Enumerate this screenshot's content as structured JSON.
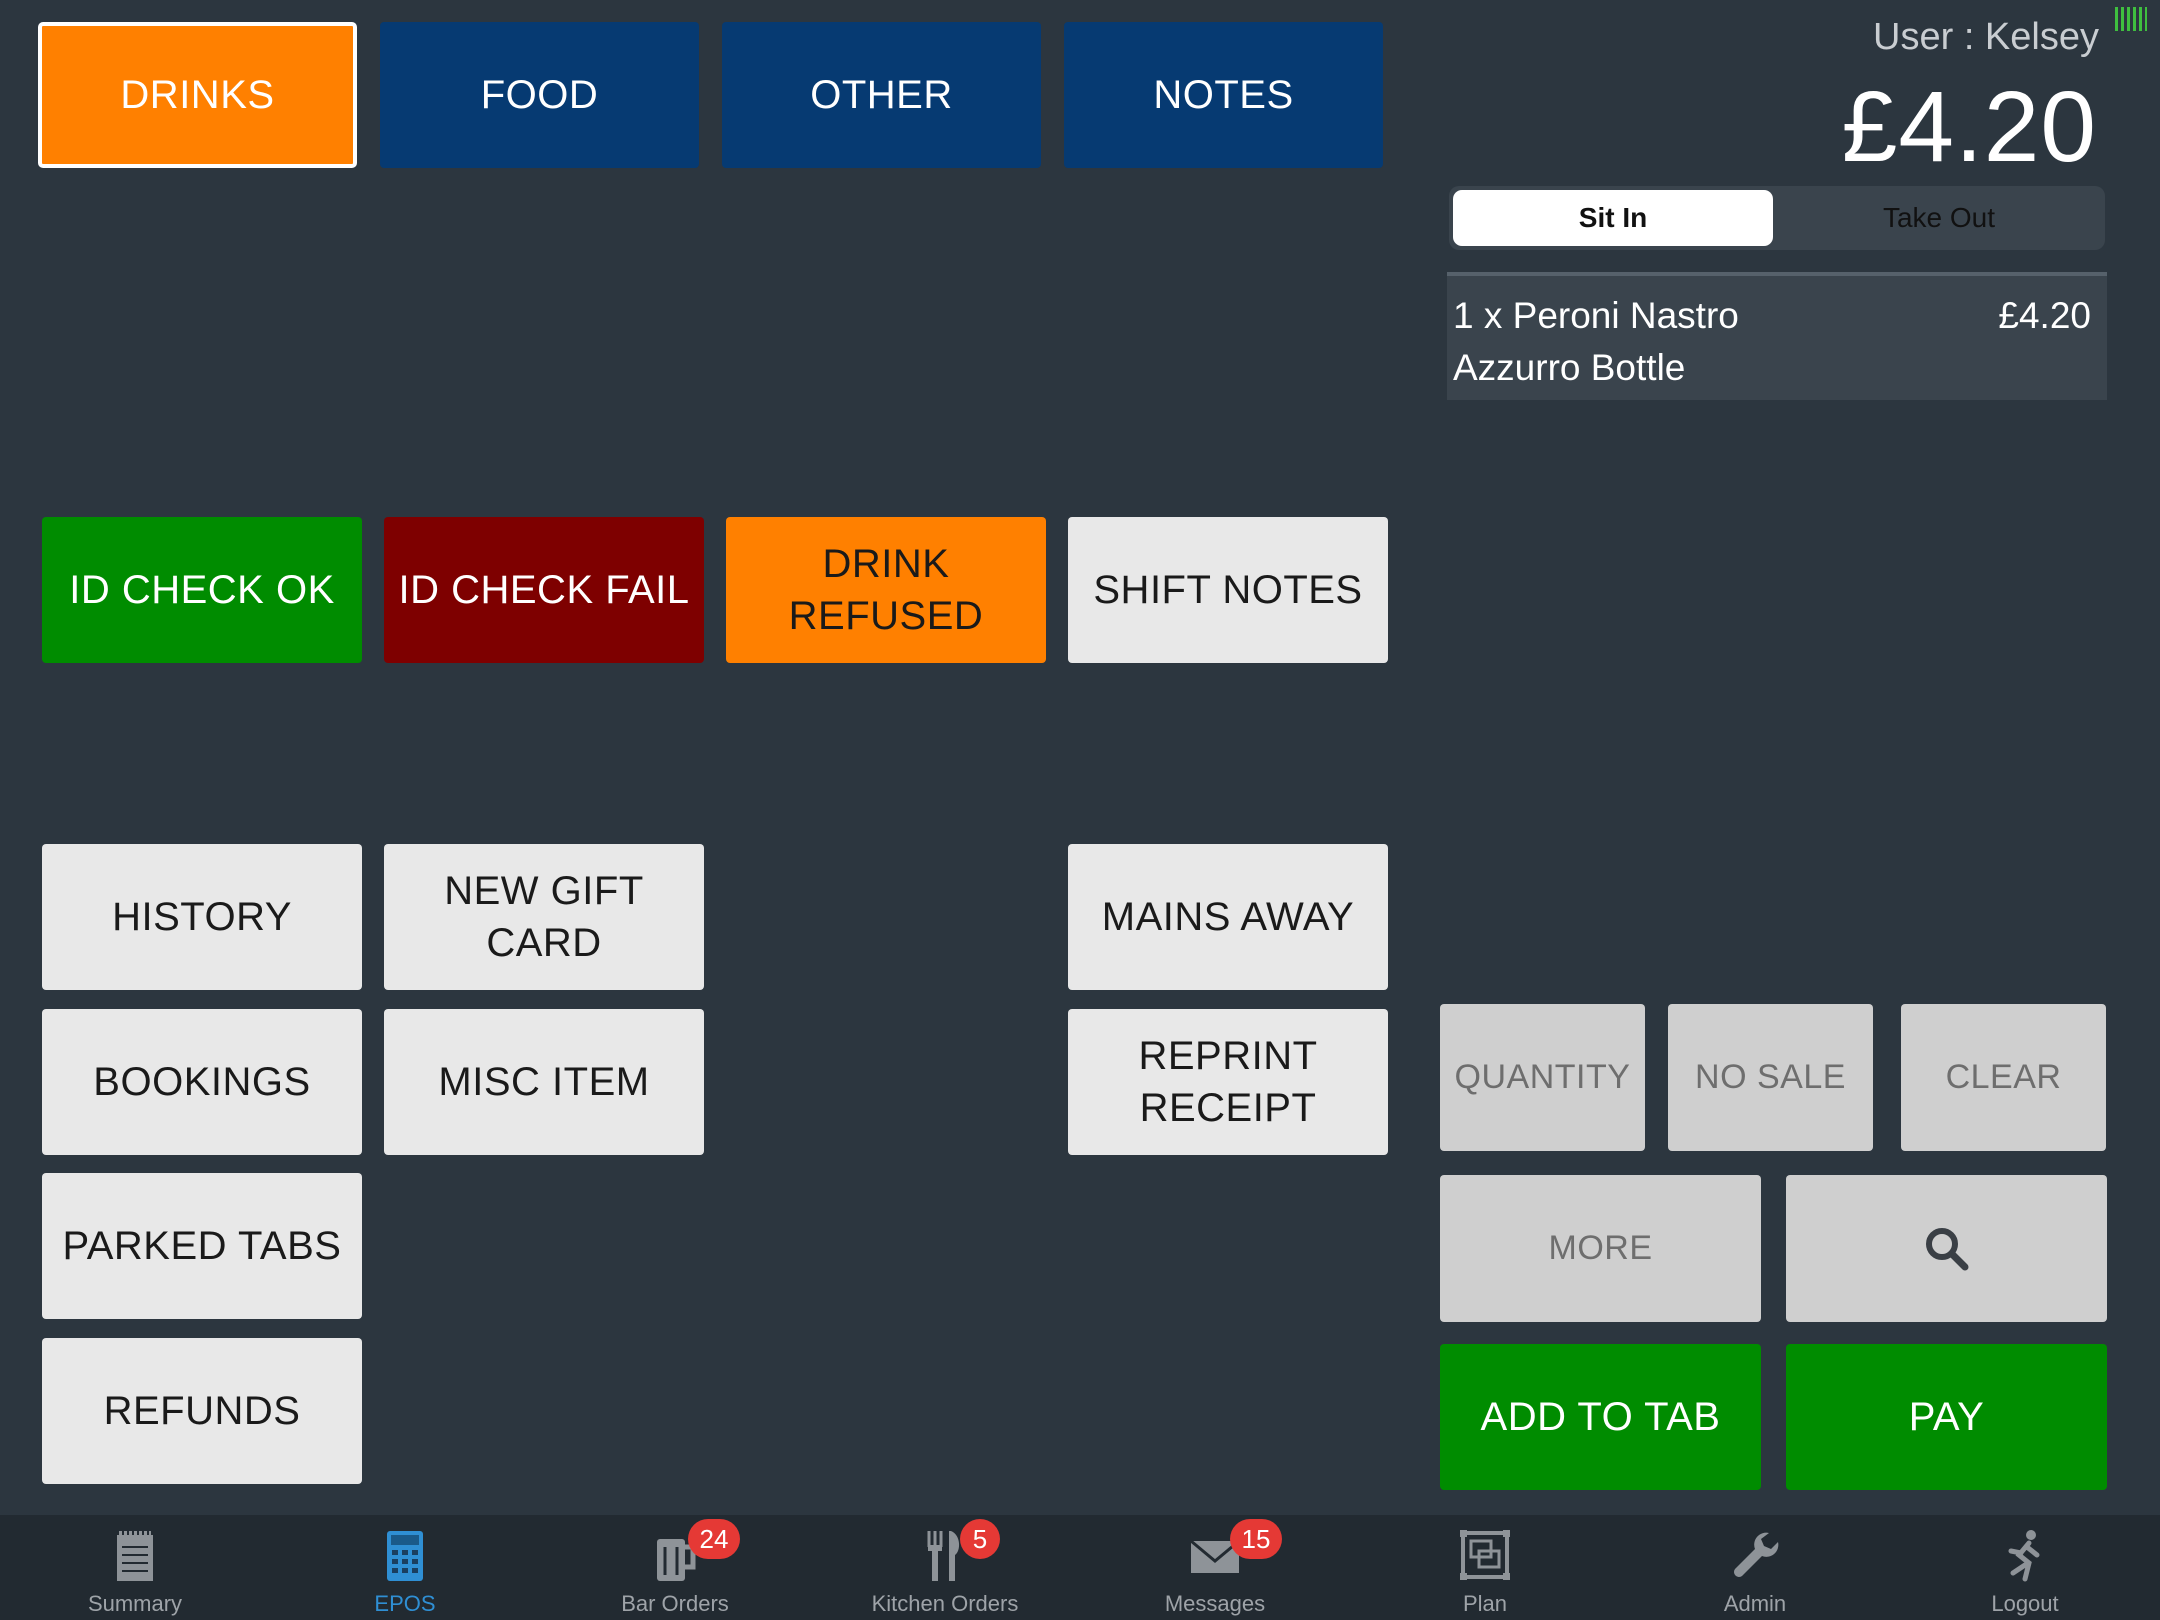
{
  "categories": [
    {
      "label": "DRINKS",
      "active": true
    },
    {
      "label": "FOOD"
    },
    {
      "label": "OTHER"
    },
    {
      "label": "NOTES"
    }
  ],
  "row_checks": {
    "id_check_ok": "ID CHECK OK",
    "id_check_fail": "ID CHECK FAIL",
    "drink_refused": "DRINK REFUSED",
    "shift_notes": "SHIFT NOTES"
  },
  "functions": {
    "history": "HISTORY",
    "new_gift_card": "NEW GIFT CARD",
    "mains_away": "MAINS AWAY",
    "bookings": "BOOKINGS",
    "misc_item": "MISC ITEM",
    "reprint_receipt_line1": "REPRINT",
    "reprint_receipt_line2": "RECEIPT",
    "parked_tabs": "PARKED TABS",
    "refunds": "REFUNDS"
  },
  "header": {
    "user": "User : Kelsey",
    "total": "£4.20"
  },
  "order_type": {
    "selected": "Sit In",
    "other": "Take Out"
  },
  "order_items": [
    {
      "name": "1 x Peroni Nastro Azzurro Bottle",
      "price": "£4.20"
    }
  ],
  "actions": {
    "quantity": "QUANTITY",
    "no_sale": "NO SALE",
    "clear": "CLEAR",
    "more": "MORE",
    "search_icon": "search-icon",
    "add_to_tab": "ADD TO TAB",
    "pay": "PAY"
  },
  "tabbar": [
    {
      "label": "Summary",
      "icon": "notepad-icon"
    },
    {
      "label": "EPOS",
      "icon": "calculator-icon",
      "active": true
    },
    {
      "label": "Bar Orders",
      "icon": "beer-mug-icon",
      "badge": "24"
    },
    {
      "label": "Kitchen Orders",
      "icon": "cutlery-icon",
      "badge": "5"
    },
    {
      "label": "Messages",
      "icon": "envelope-icon",
      "badge": "15"
    },
    {
      "label": "Plan",
      "icon": "floor-plan-icon"
    },
    {
      "label": "Admin",
      "icon": "wrench-icon"
    },
    {
      "label": "Logout",
      "icon": "running-man-icon"
    }
  ],
  "colors": {
    "background": "#2c363f",
    "category_active": "#ff8000",
    "category": "#063a72",
    "green": "#008c00",
    "dark_red": "#7e0000",
    "badge": "#e53935",
    "tab_active": "#2f8fd4"
  }
}
